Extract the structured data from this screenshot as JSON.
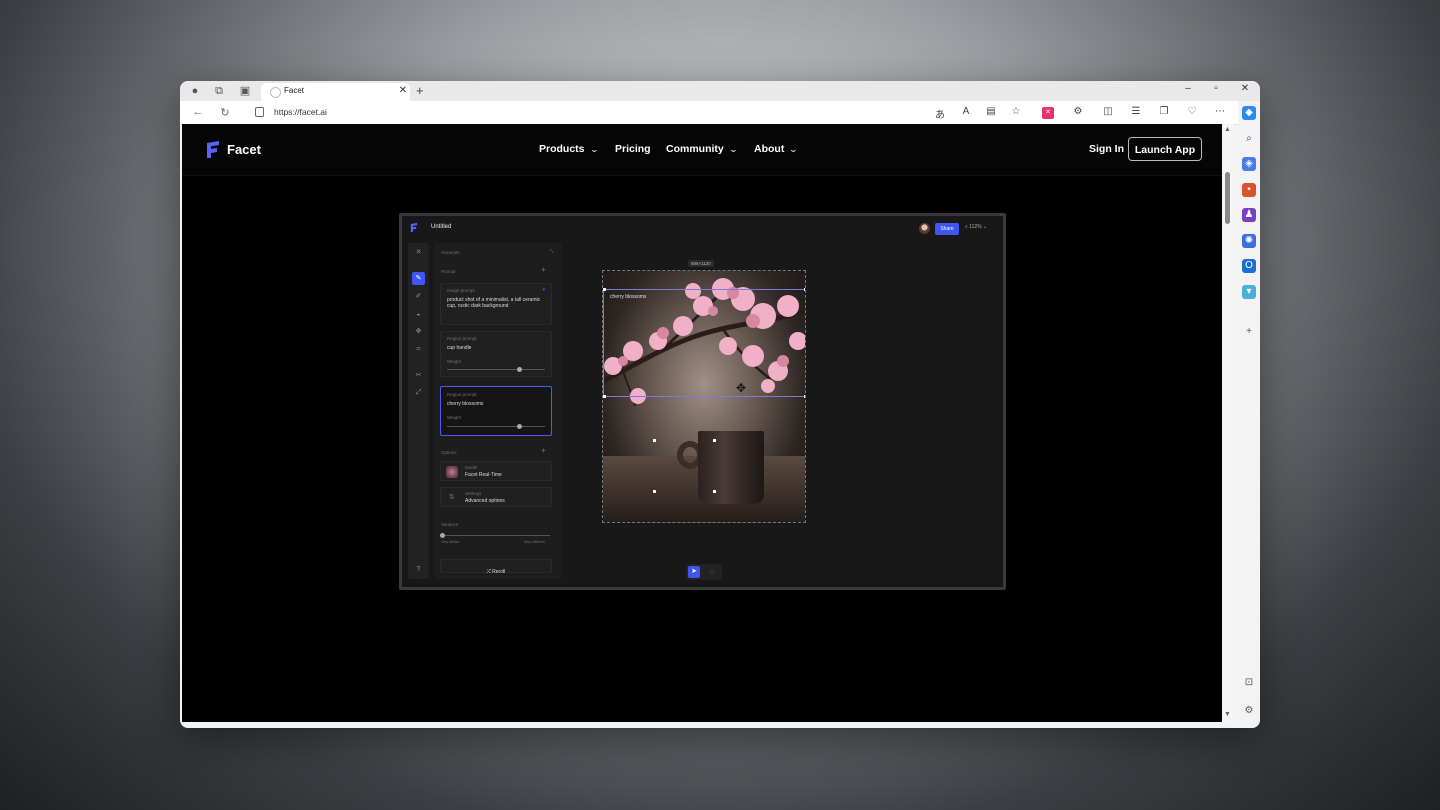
{
  "browser": {
    "tab_title": "Facet",
    "tab_close": "✕",
    "new_tab": "+",
    "url": "https://facet.ai",
    "window_controls": [
      "–",
      "▫",
      "✕"
    ]
  },
  "site": {
    "logo_text": "Facet",
    "nav": [
      {
        "label": "Products",
        "has_menu": true
      },
      {
        "label": "Pricing",
        "has_menu": false
      },
      {
        "label": "Community",
        "has_menu": true
      },
      {
        "label": "About",
        "has_menu": true
      }
    ],
    "sign_in": "Sign In",
    "launch_app": "Launch App"
  },
  "app": {
    "title": "Untitled",
    "share": "Share",
    "zoom": "112%",
    "panel": {
      "header": "Generate",
      "prompt_section": "Prompt",
      "image_prompt_label": "Image prompt",
      "image_prompt": "product shot of a minimalist, a tall ceramic cup, rustic dark background",
      "region1_label": "Region prompt",
      "region1_value": "cup handle",
      "region1_weight_label": "Weight",
      "region2_label": "Region prompt",
      "region2_value": "cherry blossoms",
      "region2_weight_label": "Weight",
      "options_section": "Options",
      "model_label": "Model",
      "model_value": "Facet Real-Time",
      "settings_label": "Settings",
      "settings_value": "Advanced options",
      "variance_label": "Variance",
      "variance_low": "Very similar",
      "variance_high": "Very different",
      "reroll": "Reroll"
    },
    "canvas": {
      "dimensions": "896×1120",
      "region_overlay_label": "cherry blossoms"
    }
  }
}
